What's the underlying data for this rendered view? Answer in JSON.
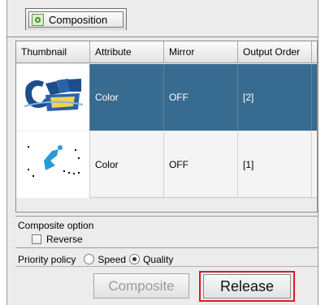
{
  "tab": {
    "label": "Composition",
    "icon": "composition-icon"
  },
  "table": {
    "columns": [
      "Thumbnail",
      "Attribute",
      "Mirror",
      "Output Order"
    ],
    "rows": [
      {
        "thumbnail": "clean-dew-logo",
        "attribute": "Color",
        "mirror": "OFF",
        "order": "[2]",
        "selected": true
      },
      {
        "thumbnail": "blue-figure-drawing",
        "attribute": "Color",
        "mirror": "OFF",
        "order": "[1]",
        "selected": false
      }
    ]
  },
  "composite_option": {
    "title": "Composite option",
    "reverse_label": "Reverse",
    "reverse_checked": false
  },
  "priority": {
    "label": "Priority policy",
    "options": [
      "Speed",
      "Quality"
    ],
    "selected": "Quality"
  },
  "buttons": {
    "composite": "Composite",
    "release": "Release"
  },
  "colors": {
    "selection": "#386b90",
    "highlight_frame": "#d32020"
  }
}
